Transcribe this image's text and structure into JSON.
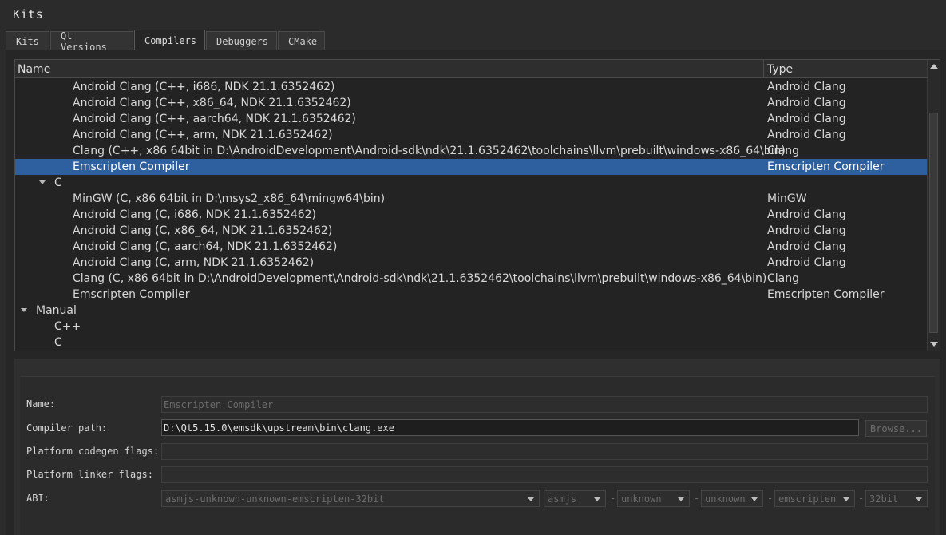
{
  "window": {
    "title": "Kits"
  },
  "tabs": [
    {
      "label": "Kits"
    },
    {
      "label": "Qt Versions"
    },
    {
      "label": "Compilers"
    },
    {
      "label": "Debuggers"
    },
    {
      "label": "CMake"
    }
  ],
  "active_tab": "Compilers",
  "tree": {
    "headers": {
      "name": "Name",
      "type": "Type"
    },
    "rows": [
      {
        "name": "Android Clang (C++, i686, NDK 21.1.6352462)",
        "type": "Android Clang"
      },
      {
        "name": "Android Clang (C++, x86_64, NDK 21.1.6352462)",
        "type": "Android Clang"
      },
      {
        "name": "Android Clang (C++, aarch64, NDK 21.1.6352462)",
        "type": "Android Clang"
      },
      {
        "name": "Android Clang (C++, arm, NDK 21.1.6352462)",
        "type": "Android Clang"
      },
      {
        "name": "Clang (C++, x86 64bit in D:\\AndroidDevelopment\\Android-sdk\\ndk\\21.1.6352462\\toolchains\\llvm\\prebuilt\\windows-x86_64\\bin)",
        "type": "Clang"
      },
      {
        "name": "Emscripten Compiler",
        "type": "Emscripten Compiler"
      },
      {
        "name": "C",
        "type": ""
      },
      {
        "name": "MinGW (C, x86 64bit in D:\\msys2_x86_64\\mingw64\\bin)",
        "type": "MinGW"
      },
      {
        "name": "Android Clang (C, i686, NDK 21.1.6352462)",
        "type": "Android Clang"
      },
      {
        "name": "Android Clang (C, x86_64, NDK 21.1.6352462)",
        "type": "Android Clang"
      },
      {
        "name": "Android Clang (C, aarch64, NDK 21.1.6352462)",
        "type": "Android Clang"
      },
      {
        "name": "Android Clang (C, arm, NDK 21.1.6352462)",
        "type": "Android Clang"
      },
      {
        "name": "Clang (C, x86 64bit in D:\\AndroidDevelopment\\Android-sdk\\ndk\\21.1.6352462\\toolchains\\llvm\\prebuilt\\windows-x86_64\\bin)",
        "type": "Clang"
      },
      {
        "name": "Emscripten Compiler",
        "type": "Emscripten Compiler"
      },
      {
        "name": "Manual",
        "type": ""
      },
      {
        "name": "C++",
        "type": ""
      },
      {
        "name": "C",
        "type": ""
      }
    ]
  },
  "details": {
    "name_label": "Name:",
    "name_value": "Emscripten Compiler",
    "compiler_path_label": "Compiler path:",
    "compiler_path_value": "D:\\Qt5.15.0\\emsdk\\upstream\\bin\\clang.exe",
    "browse_label": "Browse...",
    "codegen_label": "Platform codegen flags:",
    "codegen_value": "",
    "linker_label": "Platform linker flags:",
    "linker_value": "",
    "abi_label": "ABI:",
    "abi_main": "asmjs-unknown-unknown-emscripten-32bit",
    "abi_parts": [
      "asmjs",
      "unknown",
      "unknown",
      "emscripten",
      "32bit"
    ],
    "abi_separator": "-"
  },
  "colors": {
    "selection": "#2e5f9e",
    "background": "#2b2b2b",
    "panel": "#262626"
  }
}
